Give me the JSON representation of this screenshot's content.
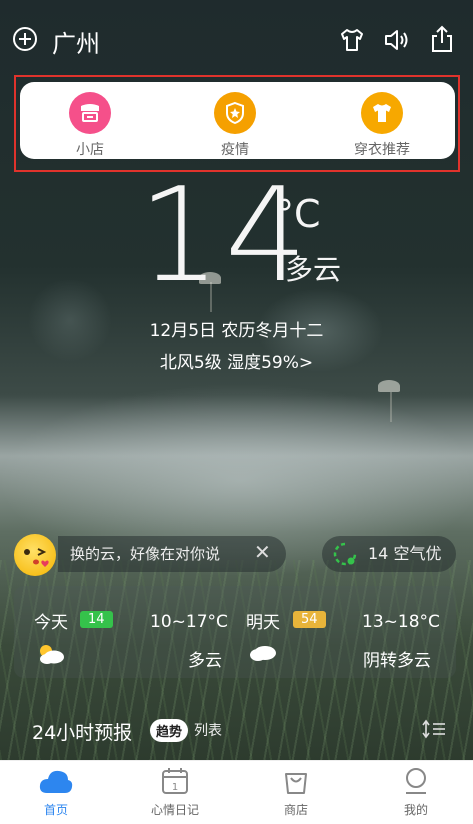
{
  "header": {
    "city": "广州",
    "icons": [
      "add-icon",
      "tshirt-icon",
      "speaker-icon",
      "share-icon"
    ]
  },
  "quick_links": [
    {
      "label": "小店",
      "icon": "shop-icon",
      "color": "#f5508a"
    },
    {
      "label": "疫情",
      "icon": "shield-star-icon",
      "color": "#f5a000"
    },
    {
      "label": "穿衣推荐",
      "icon": "tshirt-icon",
      "color": "#f7a800"
    }
  ],
  "current": {
    "temperature": "14",
    "unit": "°C",
    "condition": "多云",
    "date": "12月5日 农历冬月十二",
    "wind_humidity": "北风5级 湿度59%>"
  },
  "notice": {
    "text": "换的云，好像在对你说",
    "close_symbol": "✕"
  },
  "aqi": {
    "text": "14 空气优",
    "color": "#35c24b"
  },
  "forecast": {
    "today": {
      "label": "今天",
      "aqi": "14",
      "aqi_color": "#35c24b",
      "range": "10~17°C",
      "condition": "多云"
    },
    "tomorrow": {
      "label": "明天",
      "aqi": "54",
      "aqi_color": "#e8b43a",
      "range": "13~18°C",
      "condition": "阴转多云"
    }
  },
  "hourly": {
    "title": "24小时预报",
    "tab_active": "趋势",
    "tab_inactive": "列表"
  },
  "bottom_nav": {
    "active_color": "#2d86ef",
    "items": [
      {
        "label": "首页",
        "icon": "cloud-home-icon"
      },
      {
        "label": "心情日记",
        "icon": "calendar-icon",
        "date_num": "1"
      },
      {
        "label": "商店",
        "icon": "bag-icon"
      },
      {
        "label": "我的",
        "icon": "user-icon"
      }
    ]
  }
}
